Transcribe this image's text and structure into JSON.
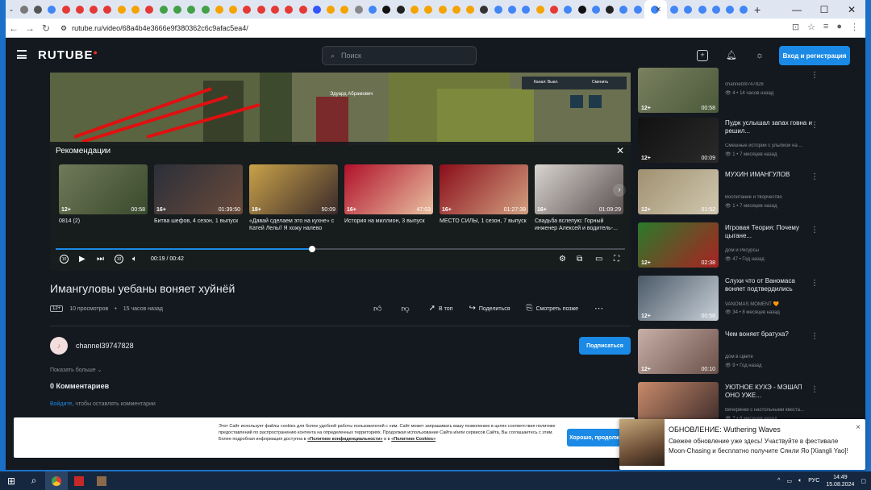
{
  "browser": {
    "tab_favicons": [
      "#7a7a7a",
      "#555",
      "#4285f4",
      "#e53935",
      "#e53935",
      "#e53935",
      "#e53935",
      "#f4a300",
      "#f4a300",
      "#e53935",
      "#43a047",
      "#43a047",
      "#43a047",
      "#43a047",
      "#f4a300",
      "#f4a300",
      "#e53935",
      "#e53935",
      "#e53935",
      "#e53935",
      "#e53935",
      "#3355ff",
      "#f4a300",
      "#f4a300",
      "#888",
      "#4285f4",
      "#111",
      "#222",
      "#f4a300",
      "#f4a300",
      "#f4a300",
      "#f4a300",
      "#f4a300",
      "#333",
      "#4285f4",
      "#4285f4",
      "#4285f4",
      "#f4a300",
      "#e53935",
      "#4285f4",
      "#111",
      "#4285f4",
      "#222",
      "#4285f4",
      "#4285f4",
      "#4285f4",
      "#4285f4",
      "#4285f4",
      "#4285f4",
      "#4285f4",
      "#4285f4",
      "#4285f4"
    ],
    "tab_close": "×",
    "new_tab": "+",
    "url": "rutube.ru/video/68a4b4e3666e9f380362c6c9afac5ea4/",
    "win_min": "—",
    "win_max": "☐",
    "win_close": "✕"
  },
  "header": {
    "logo": "RUTUBE",
    "search_placeholder": "Поиск",
    "login_label": "Вход и регистрация"
  },
  "player": {
    "overlay_channel": "Эдуард Абрамович",
    "overlay_hud": "Канал: Выкл.",
    "overlay_hud2": "Сменить",
    "recommendations_title": "Рекомендации",
    "progress": 0.45,
    "time": "00:19 / 00:42",
    "recs": [
      {
        "title": "0814 (2)",
        "age": "12+",
        "duration": "00:58",
        "c1": "#6f7a5a",
        "c2": "#3a4a2c"
      },
      {
        "title": "Битва шефов, 4 сезон, 1 выпуск",
        "age": "16+",
        "duration": "01:39:50",
        "c1": "#2b2f3a",
        "c2": "#6a4a3a"
      },
      {
        "title": "«Давай сделаем это на кухне» с Катей Лель// Я хожу налево",
        "age": "18+",
        "duration": "50:09",
        "c1": "#c9a24a",
        "c2": "#3a2a2a"
      },
      {
        "title": "История на миллион, 3 выпуск",
        "age": "16+",
        "duration": "47:03",
        "c1": "#b0102a",
        "c2": "#e8c0a0"
      },
      {
        "title": "МЕСТО СИЛЫ, 1 сезон, 7 выпуск",
        "age": "16+",
        "duration": "01:27:39",
        "c1": "#8a0d1a",
        "c2": "#d2a080"
      },
      {
        "title": "Свадьба вслепую: Горный инженер Алексей и водитель-...",
        "age": "16+",
        "duration": "01:09:29",
        "c1": "#d8d4d0",
        "c2": "#5a5050"
      }
    ]
  },
  "video": {
    "title": "Имангуловы уебаны воняет хуйнёй",
    "age": "12+",
    "views": "10 просмотров",
    "posted": "15 часов назад",
    "actions": {
      "to_top": "В топ",
      "share": "Поделиться",
      "watch_later": "Смотреть позже"
    },
    "channel": "channel39747828",
    "subscribe": "Подписаться",
    "show_more": "Показать больше",
    "comments_count": "0 Комментариев",
    "login_link": "Войдите",
    "login_rest": ", чтобы оставлять комментарии"
  },
  "sidebar": [
    {
      "title": "",
      "channel": "channel39747828",
      "stats": "4 • 14 часов назад",
      "age": "12+",
      "duration": "00:58",
      "c1": "#7a8060",
      "c2": "#4a5a3a"
    },
    {
      "title": "Пудж услышал запах говна и решил...",
      "channel": "Смешные истории с улыбкой на ...",
      "stats": "1 • 7 месяцев назад",
      "age": "12+",
      "duration": "00:09",
      "c1": "#111",
      "c2": "#2a2a2a"
    },
    {
      "title": "МУХИН ИМАНГУЛОВ",
      "channel": "Воспитание и творчество",
      "stats": "1 • 7 месяцев назад",
      "age": "12+",
      "duration": "01:52",
      "c1": "#a09070",
      "c2": "#d0c8b0"
    },
    {
      "title": "Игровая Теория: Почему цыгане...",
      "channel": "Дом и Ресурсы",
      "stats": "47 • Год назад",
      "age": "12+",
      "duration": "02:38",
      "c1": "#2a7a2a",
      "c2": "#aa2222"
    },
    {
      "title": "Слухи что от Ваномаса воняет подтвердились",
      "channel": "VANOMAS MOMENT 🧡",
      "stats": "34 • 8 месяцев назад",
      "age": "12+",
      "duration": "00:58",
      "c1": "#4a5866",
      "c2": "#c8d0d8"
    },
    {
      "title": "Чем воняет братуха?",
      "channel": "Дом в Цвете",
      "stats": "9 • Год назад",
      "age": "12+",
      "duration": "00:10",
      "c1": "#c8b0a8",
      "c2": "#6a5048"
    },
    {
      "title": "УЮТНОЕ КУХЭ - МЭШАП ОНО УЖЕ...",
      "channel": "Вечеринки с настольными квеста...",
      "stats": "7 • 8 месяцев назад",
      "age": "12+",
      "duration": "",
      "c1": "#c88a6a",
      "c2": "#3a2a2a"
    }
  ],
  "cookie": {
    "text": "Этот Сайт использует файлы cookies для более удобной работы пользователей с ним. Сайт может запрашивать вашу позволению в целях соответствия политике предоставлений по распространению контента на определенных территориях. Продолжая использование Сайта и/или сервисов Сайта, Вы соглашаетесь с этим. Более подробная информация доступна в ",
    "link1": "«Политике конфиденциальности»",
    "and": " и в ",
    "link2": "«Политике Cookies»",
    "ok": "Хорошо, продолжить"
  },
  "notification": {
    "title": "ОБНОВЛЕНИЕ: Wuthering Waves",
    "body": "Свежее обновление уже здесь! Участвуйте в фестивале Moon-Chasing и бесплатно получите Сянли Яо [Xiangli Yao]!",
    "close": "×"
  },
  "taskbar": {
    "lang": "РУС",
    "time": "14:49",
    "date": "15.08.2024"
  }
}
